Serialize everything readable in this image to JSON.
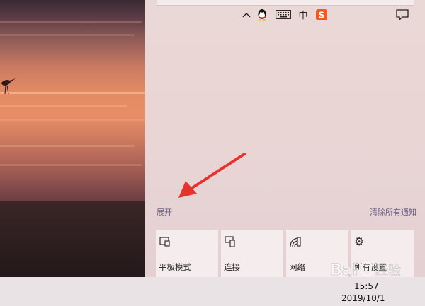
{
  "action_center": {
    "expand_label": "展开",
    "clear_all_label": "清除所有通知",
    "tiles": [
      {
        "label": "平板模式",
        "icon": "tablet-mode-icon"
      },
      {
        "label": "连接",
        "icon": "connect-icon"
      },
      {
        "label": "网络",
        "icon": "network-icon"
      },
      {
        "label": "所有设置",
        "icon": "gear-icon"
      }
    ]
  },
  "taskbar": {
    "ime_label": "中",
    "time": "15:57",
    "date": "2019/10/1"
  },
  "watermark": {
    "text": "Baidu 经验"
  },
  "colors": {
    "annotation_arrow": "#e8332c",
    "link": "#6b5e86"
  }
}
